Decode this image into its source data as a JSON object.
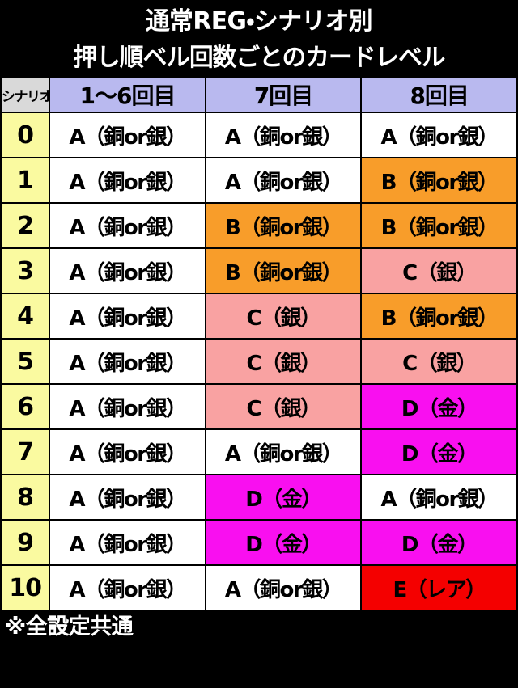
{
  "title": {
    "line1": "通常REG・シナリオ別",
    "line2": "押し順ベル回数ごとのカードレベル"
  },
  "table": {
    "headers": {
      "scenario": "シナリオ",
      "col1": "1〜6回目",
      "col2": "7回目",
      "col3": "8回目"
    },
    "rows": [
      {
        "scenario": "0",
        "c1": "A（銅or銀）",
        "c1_level": "A",
        "c2": "A（銅or銀）",
        "c2_level": "A",
        "c3": "A（銅or銀）",
        "c3_level": "A"
      },
      {
        "scenario": "1",
        "c1": "A（銅or銀）",
        "c1_level": "A",
        "c2": "A（銅or銀）",
        "c2_level": "A",
        "c3": "B（銅or銀）",
        "c3_level": "B"
      },
      {
        "scenario": "2",
        "c1": "A（銅or銀）",
        "c1_level": "A",
        "c2": "B（銅or銀）",
        "c2_level": "B",
        "c3": "B（銅or銀）",
        "c3_level": "B"
      },
      {
        "scenario": "3",
        "c1": "A（銅or銀）",
        "c1_level": "A",
        "c2": "B（銅or銀）",
        "c2_level": "B",
        "c3": "C（銀）",
        "c3_level": "C"
      },
      {
        "scenario": "4",
        "c1": "A（銅or銀）",
        "c1_level": "A",
        "c2": "C（銀）",
        "c2_level": "C",
        "c3": "B（銅or銀）",
        "c3_level": "B"
      },
      {
        "scenario": "5",
        "c1": "A（銅or銀）",
        "c1_level": "A",
        "c2": "C（銀）",
        "c2_level": "C",
        "c3": "C（銀）",
        "c3_level": "C"
      },
      {
        "scenario": "6",
        "c1": "A（銅or銀）",
        "c1_level": "A",
        "c2": "C（銀）",
        "c2_level": "C",
        "c3": "D（金）",
        "c3_level": "D"
      },
      {
        "scenario": "7",
        "c1": "A（銅or銀）",
        "c1_level": "A",
        "c2": "A（銅or銀）",
        "c2_level": "A",
        "c3": "D（金）",
        "c3_level": "D"
      },
      {
        "scenario": "8",
        "c1": "A（銅or銀）",
        "c1_level": "A",
        "c2": "D（金）",
        "c2_level": "D",
        "c3": "A（銅or銀）",
        "c3_level": "A"
      },
      {
        "scenario": "9",
        "c1": "A（銅or銀）",
        "c1_level": "A",
        "c2": "D（金）",
        "c2_level": "D",
        "c3": "D（金）",
        "c3_level": "D"
      },
      {
        "scenario": "10",
        "c1": "A（銅or銀）",
        "c1_level": "A",
        "c2": "A（銅or銀）",
        "c2_level": "A",
        "c3": "E（レア）",
        "c3_level": "E"
      }
    ]
  },
  "footnote": "※全設定共通",
  "colors": {
    "background": "#000000",
    "title_text": "#ffffff",
    "header_cell": "#b9b9ef",
    "scenario_header_cell": "#d9d9d9",
    "scenario_cell": "#fafaa0",
    "level_a": "#ffffff",
    "level_b": "#f89d2a",
    "level_c": "#f9a2a2",
    "level_d": "#f90ff0",
    "level_e": "#f40000"
  }
}
